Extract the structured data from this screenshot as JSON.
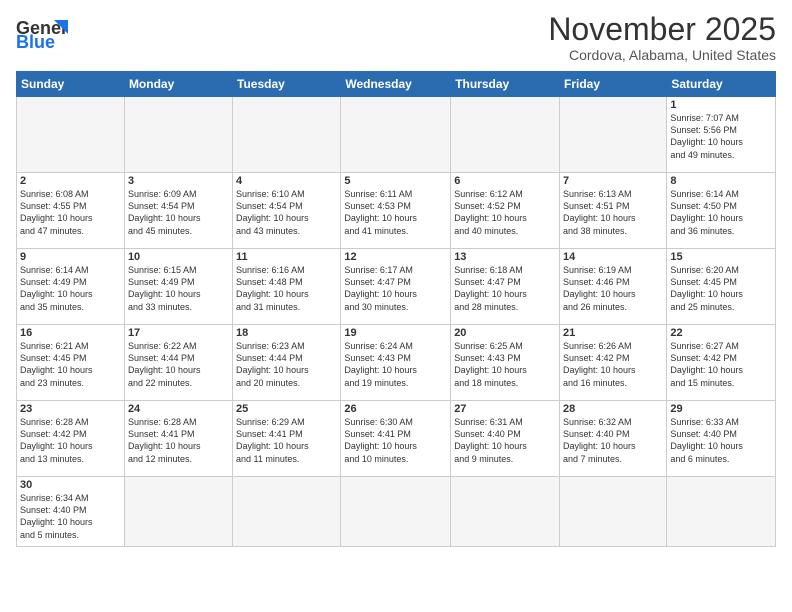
{
  "header": {
    "logo_text_general": "General",
    "logo_text_blue": "Blue",
    "month_title": "November 2025",
    "location": "Cordova, Alabama, United States"
  },
  "weekdays": [
    "Sunday",
    "Monday",
    "Tuesday",
    "Wednesday",
    "Thursday",
    "Friday",
    "Saturday"
  ],
  "weeks": [
    [
      {
        "day": "",
        "info": ""
      },
      {
        "day": "",
        "info": ""
      },
      {
        "day": "",
        "info": ""
      },
      {
        "day": "",
        "info": ""
      },
      {
        "day": "",
        "info": ""
      },
      {
        "day": "",
        "info": ""
      },
      {
        "day": "1",
        "info": "Sunrise: 7:07 AM\nSunset: 5:56 PM\nDaylight: 10 hours\nand 49 minutes."
      }
    ],
    [
      {
        "day": "2",
        "info": "Sunrise: 6:08 AM\nSunset: 4:55 PM\nDaylight: 10 hours\nand 47 minutes."
      },
      {
        "day": "3",
        "info": "Sunrise: 6:09 AM\nSunset: 4:54 PM\nDaylight: 10 hours\nand 45 minutes."
      },
      {
        "day": "4",
        "info": "Sunrise: 6:10 AM\nSunset: 4:54 PM\nDaylight: 10 hours\nand 43 minutes."
      },
      {
        "day": "5",
        "info": "Sunrise: 6:11 AM\nSunset: 4:53 PM\nDaylight: 10 hours\nand 41 minutes."
      },
      {
        "day": "6",
        "info": "Sunrise: 6:12 AM\nSunset: 4:52 PM\nDaylight: 10 hours\nand 40 minutes."
      },
      {
        "day": "7",
        "info": "Sunrise: 6:13 AM\nSunset: 4:51 PM\nDaylight: 10 hours\nand 38 minutes."
      },
      {
        "day": "8",
        "info": "Sunrise: 6:14 AM\nSunset: 4:50 PM\nDaylight: 10 hours\nand 36 minutes."
      }
    ],
    [
      {
        "day": "9",
        "info": "Sunrise: 6:14 AM\nSunset: 4:49 PM\nDaylight: 10 hours\nand 35 minutes."
      },
      {
        "day": "10",
        "info": "Sunrise: 6:15 AM\nSunset: 4:49 PM\nDaylight: 10 hours\nand 33 minutes."
      },
      {
        "day": "11",
        "info": "Sunrise: 6:16 AM\nSunset: 4:48 PM\nDaylight: 10 hours\nand 31 minutes."
      },
      {
        "day": "12",
        "info": "Sunrise: 6:17 AM\nSunset: 4:47 PM\nDaylight: 10 hours\nand 30 minutes."
      },
      {
        "day": "13",
        "info": "Sunrise: 6:18 AM\nSunset: 4:47 PM\nDaylight: 10 hours\nand 28 minutes."
      },
      {
        "day": "14",
        "info": "Sunrise: 6:19 AM\nSunset: 4:46 PM\nDaylight: 10 hours\nand 26 minutes."
      },
      {
        "day": "15",
        "info": "Sunrise: 6:20 AM\nSunset: 4:45 PM\nDaylight: 10 hours\nand 25 minutes."
      }
    ],
    [
      {
        "day": "16",
        "info": "Sunrise: 6:21 AM\nSunset: 4:45 PM\nDaylight: 10 hours\nand 23 minutes."
      },
      {
        "day": "17",
        "info": "Sunrise: 6:22 AM\nSunset: 4:44 PM\nDaylight: 10 hours\nand 22 minutes."
      },
      {
        "day": "18",
        "info": "Sunrise: 6:23 AM\nSunset: 4:44 PM\nDaylight: 10 hours\nand 20 minutes."
      },
      {
        "day": "19",
        "info": "Sunrise: 6:24 AM\nSunset: 4:43 PM\nDaylight: 10 hours\nand 19 minutes."
      },
      {
        "day": "20",
        "info": "Sunrise: 6:25 AM\nSunset: 4:43 PM\nDaylight: 10 hours\nand 18 minutes."
      },
      {
        "day": "21",
        "info": "Sunrise: 6:26 AM\nSunset: 4:42 PM\nDaylight: 10 hours\nand 16 minutes."
      },
      {
        "day": "22",
        "info": "Sunrise: 6:27 AM\nSunset: 4:42 PM\nDaylight: 10 hours\nand 15 minutes."
      }
    ],
    [
      {
        "day": "23",
        "info": "Sunrise: 6:28 AM\nSunset: 4:42 PM\nDaylight: 10 hours\nand 13 minutes."
      },
      {
        "day": "24",
        "info": "Sunrise: 6:28 AM\nSunset: 4:41 PM\nDaylight: 10 hours\nand 12 minutes."
      },
      {
        "day": "25",
        "info": "Sunrise: 6:29 AM\nSunset: 4:41 PM\nDaylight: 10 hours\nand 11 minutes."
      },
      {
        "day": "26",
        "info": "Sunrise: 6:30 AM\nSunset: 4:41 PM\nDaylight: 10 hours\nand 10 minutes."
      },
      {
        "day": "27",
        "info": "Sunrise: 6:31 AM\nSunset: 4:40 PM\nDaylight: 10 hours\nand 9 minutes."
      },
      {
        "day": "28",
        "info": "Sunrise: 6:32 AM\nSunset: 4:40 PM\nDaylight: 10 hours\nand 7 minutes."
      },
      {
        "day": "29",
        "info": "Sunrise: 6:33 AM\nSunset: 4:40 PM\nDaylight: 10 hours\nand 6 minutes."
      }
    ],
    [
      {
        "day": "30",
        "info": "Sunrise: 6:34 AM\nSunset: 4:40 PM\nDaylight: 10 hours\nand 5 minutes."
      },
      {
        "day": "",
        "info": ""
      },
      {
        "day": "",
        "info": ""
      },
      {
        "day": "",
        "info": ""
      },
      {
        "day": "",
        "info": ""
      },
      {
        "day": "",
        "info": ""
      },
      {
        "day": "",
        "info": ""
      }
    ]
  ]
}
